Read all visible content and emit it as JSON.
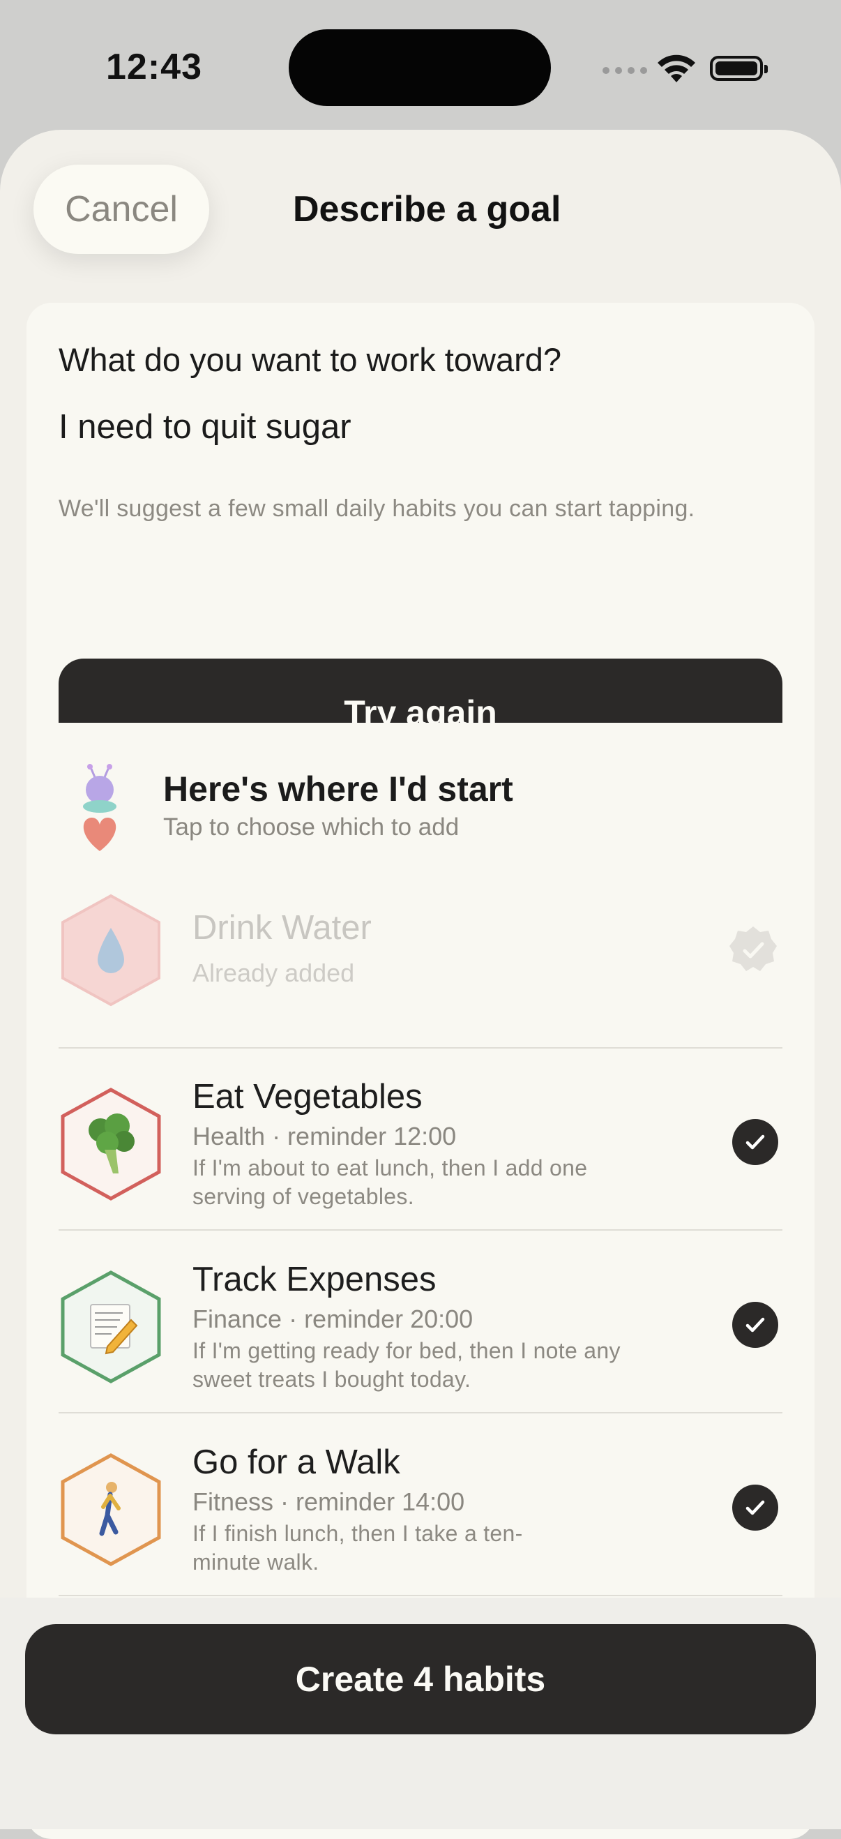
{
  "status": {
    "time": "12:43"
  },
  "header": {
    "cancel_label": "Cancel",
    "title": "Describe a goal"
  },
  "goal": {
    "question": "What do you want to work toward?",
    "value": "I need to quit sugar",
    "hint": "We'll suggest a few small daily habits you can start tapping.",
    "retry_label": "Try again"
  },
  "suggestions": {
    "title": "Here's where I'd start",
    "subtitle": "Tap to choose which to add",
    "items": [
      {
        "name": "Drink Water",
        "meta": "Already added",
        "description": "",
        "icon": "water-drop-icon",
        "color": "#e6a8a6",
        "state": "added"
      },
      {
        "name": "Eat Vegetables",
        "meta": "Health · reminder 12:00",
        "description": "If I'm about to eat lunch, then I add one serving of vegetables.",
        "icon": "broccoli-icon",
        "color": "#d2605c",
        "state": "selected"
      },
      {
        "name": "Track Expenses",
        "meta": "Finance · reminder 20:00",
        "description": "If I'm getting ready for bed, then I note any sweet treats I bought today.",
        "icon": "memo-icon",
        "color": "#5aa06a",
        "state": "selected"
      },
      {
        "name": "Go for a Walk",
        "meta": "Fitness · reminder 14:00",
        "description": "If I finish lunch, then I take a ten-minute walk.",
        "icon": "walking-person-icon",
        "color": "#e0954f",
        "state": "selected"
      }
    ]
  },
  "footer": {
    "create_label": "Create 4 habits"
  }
}
